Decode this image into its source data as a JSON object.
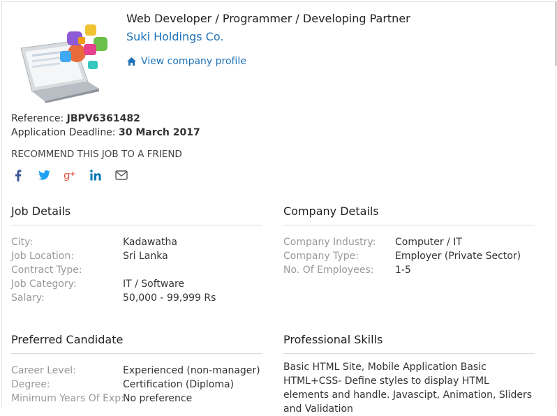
{
  "header": {
    "job_title": "Web Developer / Programmer / Developing Partner",
    "company_name": "Suki Holdings Co.",
    "view_profile": "View company profile"
  },
  "meta": {
    "reference_label": "Reference:",
    "reference_value": "JBPV6361482",
    "deadline_label": "Application Deadline:",
    "deadline_value": "30 March 2017"
  },
  "recommend_label": "RECOMMEND THIS JOB TO A FRIEND",
  "social": [
    "facebook-icon",
    "twitter-icon",
    "google-plus-icon",
    "linkedin-icon",
    "email-icon"
  ],
  "job_details": {
    "title": "Job Details",
    "rows": [
      {
        "label": "City:",
        "value": "Kadawatha"
      },
      {
        "label": "Job Location:",
        "value": "Sri Lanka"
      },
      {
        "label": "Contract Type:",
        "value": ""
      },
      {
        "label": "Job Category:",
        "value": "IT / Software"
      },
      {
        "label": "Salary:",
        "value": "50,000 - 99,999 Rs"
      }
    ]
  },
  "company_details": {
    "title": "Company Details",
    "rows": [
      {
        "label": "Company Industry:",
        "value": "Computer / IT"
      },
      {
        "label": "Company Type:",
        "value": "Employer (Private Sector)"
      },
      {
        "label": "No. Of Employees:",
        "value": "1-5"
      }
    ]
  },
  "preferred_candidate": {
    "title": "Preferred Candidate",
    "rows": [
      {
        "label": "Career Level:",
        "value": "Experienced (non-manager)"
      },
      {
        "label": "Degree:",
        "value": "Certification (Diploma)"
      },
      {
        "label": "Minimum Years Of Exp:",
        "value": "No preference"
      }
    ]
  },
  "professional_skills": {
    "title": "Professional Skills",
    "text": "Basic HTML Site, Mobile Application Basic HTML+CSS- Define styles to display HTML elements and handle. Javascipt, Animation, Sliders and Validation"
  },
  "colors": {
    "link": "#1e72b8",
    "facebook": "#3b5998",
    "twitter": "#1da1f2",
    "google_plus": "#dd4b39",
    "linkedin": "#0077b5"
  }
}
